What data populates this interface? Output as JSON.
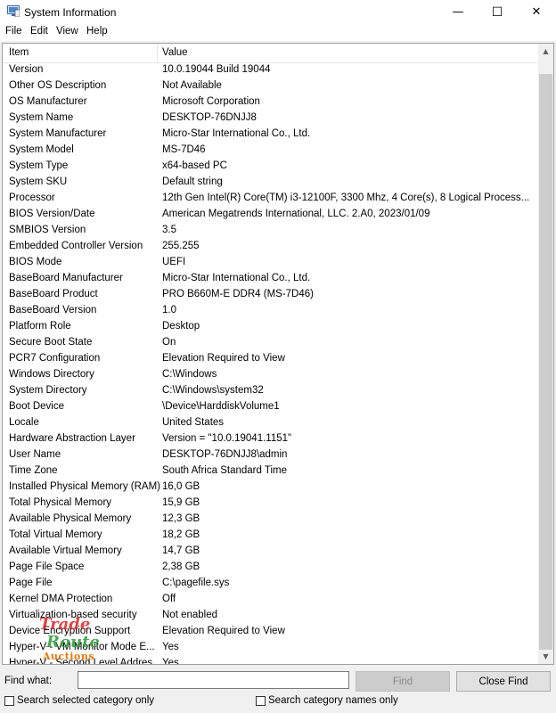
{
  "window": {
    "title": "System Information",
    "minimize_glyph": "—",
    "maximize_glyph": "☐",
    "close_glyph": "✕"
  },
  "menu": [
    "File",
    "Edit",
    "View",
    "Help"
  ],
  "table": {
    "headers": {
      "item": "Item",
      "value": "Value"
    },
    "rows": [
      {
        "item": "Version",
        "value": "10.0.19044 Build 19044"
      },
      {
        "item": "Other OS Description",
        "value": "Not Available"
      },
      {
        "item": "OS Manufacturer",
        "value": "Microsoft Corporation"
      },
      {
        "item": "System Name",
        "value": "DESKTOP-76DNJJ8"
      },
      {
        "item": "System Manufacturer",
        "value": "Micro-Star International Co., Ltd."
      },
      {
        "item": "System Model",
        "value": "MS-7D46"
      },
      {
        "item": "System Type",
        "value": "x64-based PC"
      },
      {
        "item": "System SKU",
        "value": "Default string"
      },
      {
        "item": "Processor",
        "value": "12th Gen Intel(R) Core(TM) i3-12100F, 3300 Mhz, 4 Core(s), 8 Logical Process..."
      },
      {
        "item": "BIOS Version/Date",
        "value": "American Megatrends International, LLC. 2.A0, 2023/01/09"
      },
      {
        "item": "SMBIOS Version",
        "value": "3.5"
      },
      {
        "item": "Embedded Controller Version",
        "value": "255.255"
      },
      {
        "item": "BIOS Mode",
        "value": "UEFI"
      },
      {
        "item": "BaseBoard Manufacturer",
        "value": "Micro-Star International Co., Ltd."
      },
      {
        "item": "BaseBoard Product",
        "value": "PRO B660M-E DDR4 (MS-7D46)"
      },
      {
        "item": "BaseBoard Version",
        "value": "1.0"
      },
      {
        "item": "Platform Role",
        "value": "Desktop"
      },
      {
        "item": "Secure Boot State",
        "value": "On"
      },
      {
        "item": "PCR7 Configuration",
        "value": "Elevation Required to View"
      },
      {
        "item": "Windows Directory",
        "value": "C:\\Windows"
      },
      {
        "item": "System Directory",
        "value": "C:\\Windows\\system32"
      },
      {
        "item": "Boot Device",
        "value": "\\Device\\HarddiskVolume1"
      },
      {
        "item": "Locale",
        "value": "United States"
      },
      {
        "item": "Hardware Abstraction Layer",
        "value": "Version = \"10.0.19041.1151\""
      },
      {
        "item": "User Name",
        "value": "DESKTOP-76DNJJ8\\admin"
      },
      {
        "item": "Time Zone",
        "value": "South Africa Standard Time"
      },
      {
        "item": "Installed Physical Memory (RAM)",
        "value": "16,0 GB"
      },
      {
        "item": "Total Physical Memory",
        "value": "15,9 GB"
      },
      {
        "item": "Available Physical Memory",
        "value": "12,3 GB"
      },
      {
        "item": "Total Virtual Memory",
        "value": "18,2 GB"
      },
      {
        "item": "Available Virtual Memory",
        "value": "14,7 GB"
      },
      {
        "item": "Page File Space",
        "value": "2,38 GB"
      },
      {
        "item": "Page File",
        "value": "C:\\pagefile.sys"
      },
      {
        "item": "Kernel DMA Protection",
        "value": "Off"
      },
      {
        "item": "Virtualization-based security",
        "value": "Not enabled"
      },
      {
        "item": "Device Encryption Support",
        "value": "Elevation Required to View"
      },
      {
        "item": "Hyper-V - VM Monitor Mode E...",
        "value": "Yes"
      },
      {
        "item": "Hyper-V - Second Level Addres...",
        "value": "Yes"
      }
    ]
  },
  "watermark": {
    "line1": "Trade",
    "line2": "Route",
    "line3": "Auctions"
  },
  "find": {
    "label": "Find what:",
    "value": "",
    "find_button": "Find",
    "close_button": "Close Find",
    "check_selected": "Search selected category only",
    "check_names": "Search category names only"
  }
}
